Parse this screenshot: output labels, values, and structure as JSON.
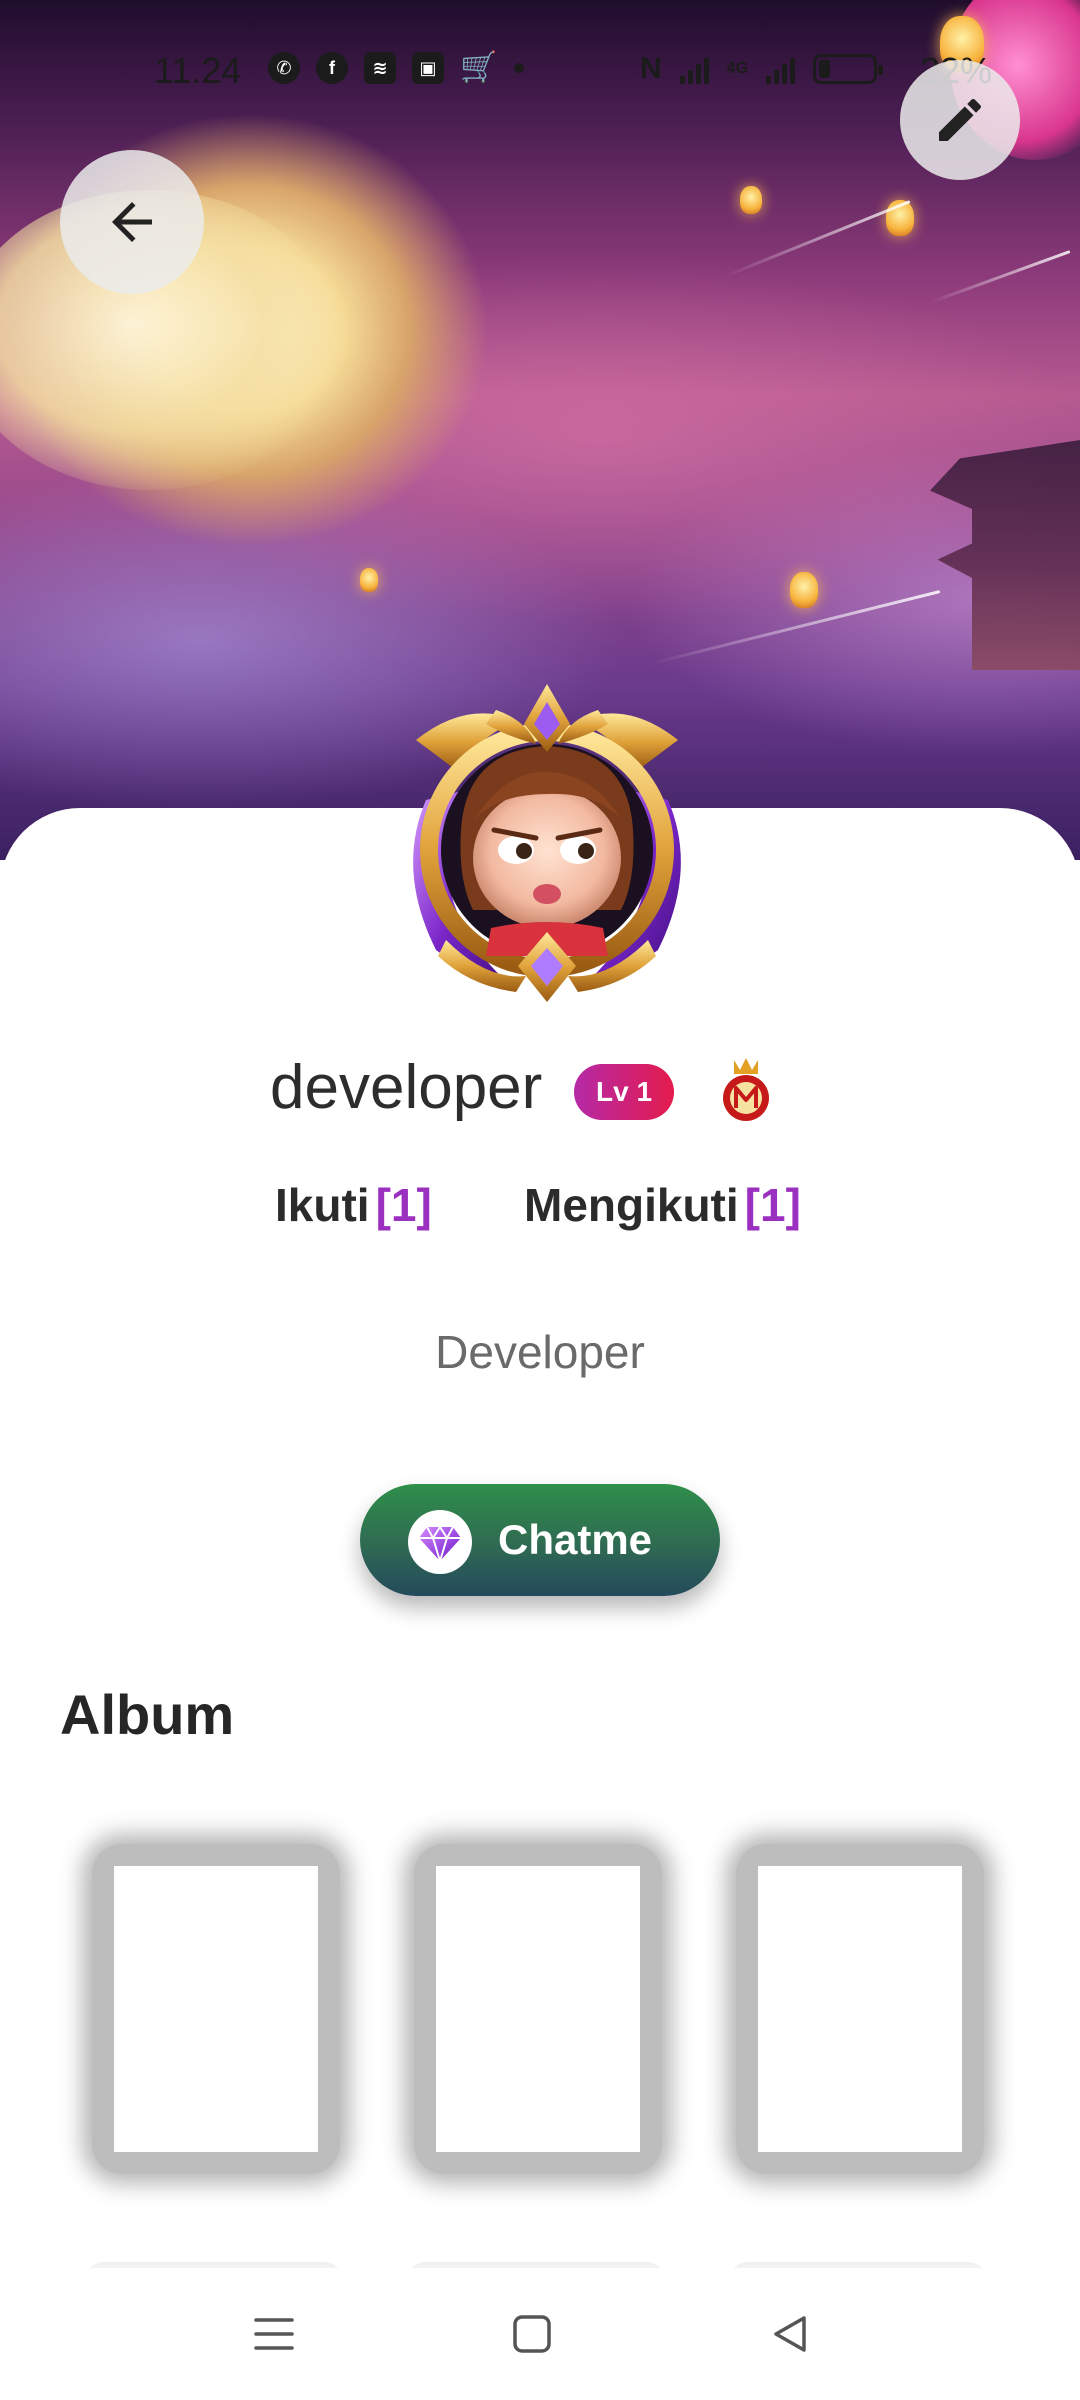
{
  "status_bar": {
    "time": "11.24",
    "network": "4G",
    "battery_percent": "22%",
    "battery_level": 0.22,
    "notification_icons": [
      "whatsapp-icon",
      "facebook-icon",
      "app-icon",
      "robot-icon",
      "shopping-cart-icon"
    ]
  },
  "header": {
    "back_icon": "arrow-left-icon",
    "edit_icon": "pencil-icon"
  },
  "profile": {
    "username": "developer",
    "level_badge": "Lv 1",
    "medal_icon": "m-medal-icon",
    "followers_label": "Ikuti",
    "followers_count": "[1]",
    "following_label": "Mengikuti",
    "following_count": "[1]",
    "bio": "Developer"
  },
  "chat_button": {
    "label": "Chatme",
    "icon": "diamond-icon"
  },
  "album": {
    "title": "Album",
    "items": [
      {
        "name": "album-photo-1"
      },
      {
        "name": "album-photo-2"
      },
      {
        "name": "album-photo-3"
      }
    ]
  },
  "nav_bar": {
    "menu_icon": "menu-icon",
    "home_icon": "home-square-icon",
    "back_icon": "back-triangle-icon"
  },
  "colors": {
    "accent_purple": "#9b2fc0",
    "chat_green": "#2f6a52",
    "level_gradient_start": "#b52aa8",
    "level_gradient_end": "#e31b4c"
  }
}
